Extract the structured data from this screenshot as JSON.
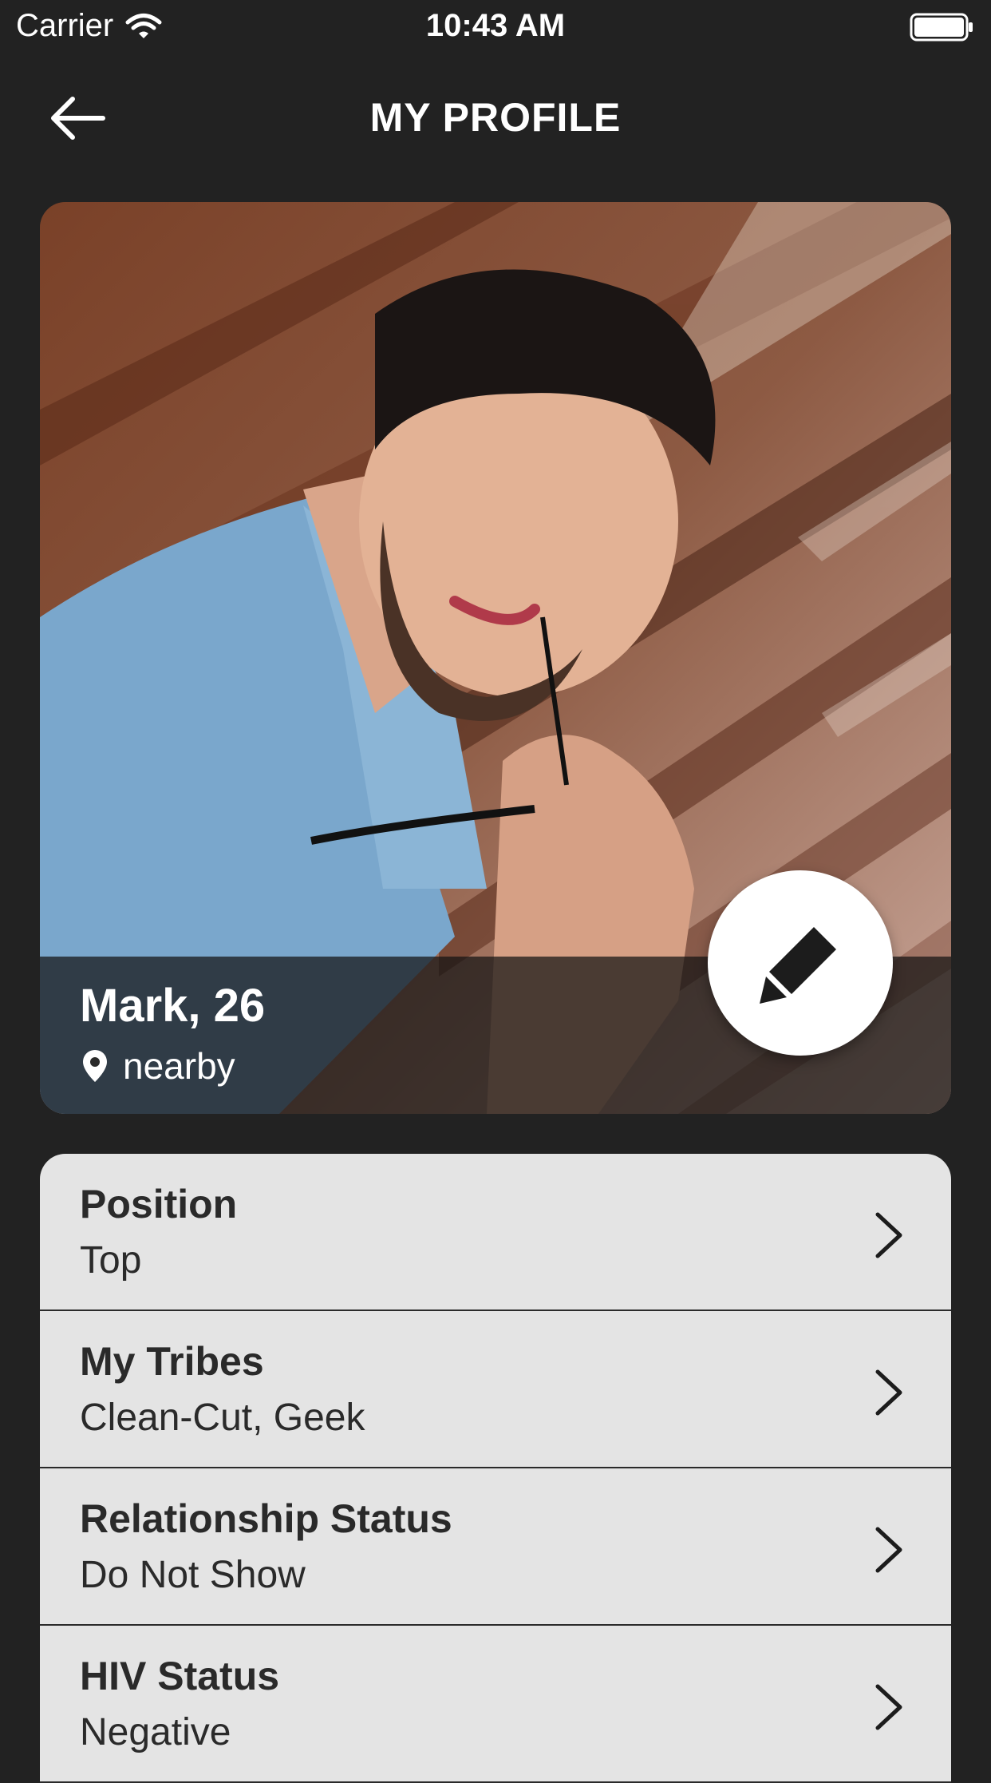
{
  "status_bar": {
    "carrier": "Carrier",
    "time": "10:43 AM"
  },
  "nav": {
    "title": "MY PROFILE",
    "back_icon": "arrow-left-icon"
  },
  "profile": {
    "name_age": "Mark, 26",
    "location": "nearby",
    "location_icon": "map-pin-icon",
    "edit_icon": "pencil-icon"
  },
  "info": {
    "rows": [
      {
        "label": "Position",
        "value": "Top"
      },
      {
        "label": "My Tribes",
        "value": "Clean-Cut, Geek"
      },
      {
        "label": "Relationship Status",
        "value": "Do Not Show"
      },
      {
        "label": "HIV Status",
        "value": "Negative"
      }
    ]
  },
  "colors": {
    "background": "#222222",
    "row_background": "#e4e4e4",
    "row_text": "#2a2a2a",
    "accent_white": "#ffffff"
  }
}
